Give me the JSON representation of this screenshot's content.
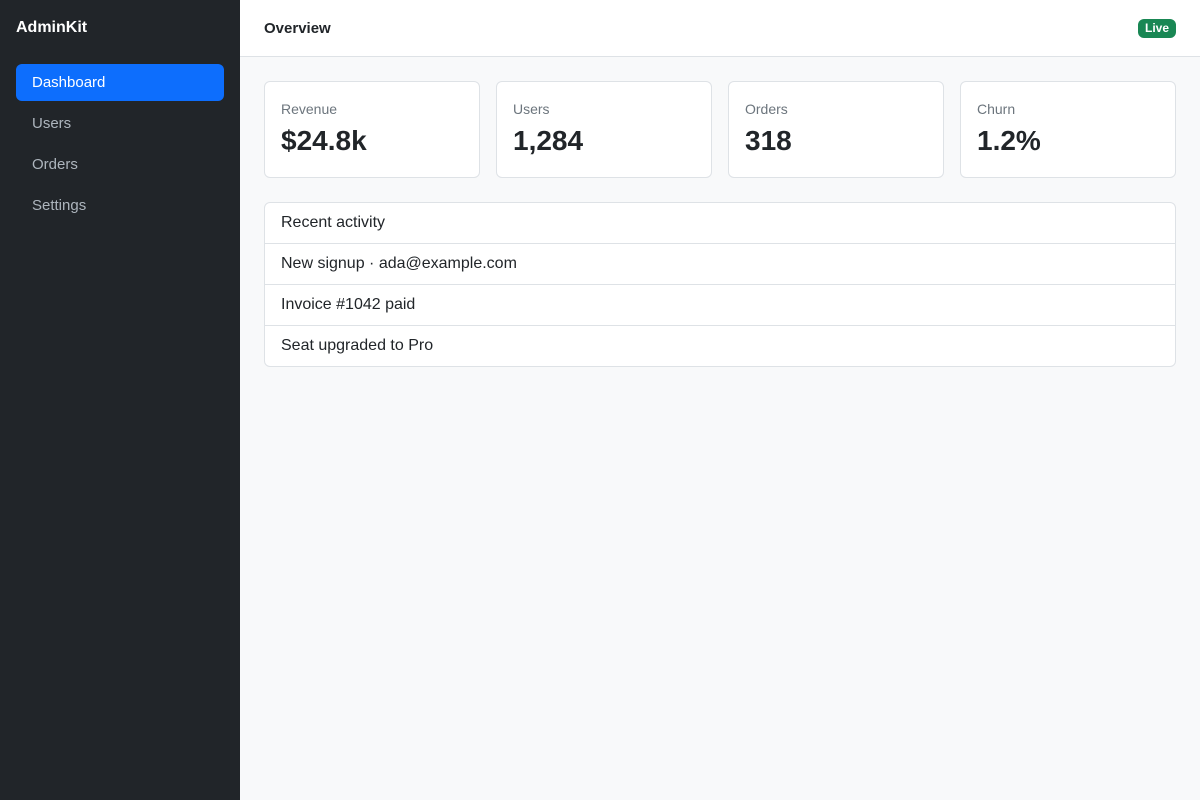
{
  "app": {
    "brand": "AdminKit"
  },
  "sidebar": {
    "items": [
      {
        "label": "Dashboard",
        "active": true
      },
      {
        "label": "Users",
        "active": false
      },
      {
        "label": "Orders",
        "active": false
      },
      {
        "label": "Settings",
        "active": false
      }
    ]
  },
  "header": {
    "title": "Overview",
    "badge": "Live"
  },
  "stats": [
    {
      "label": "Revenue",
      "value": "$24.8k"
    },
    {
      "label": "Users",
      "value": "1,284"
    },
    {
      "label": "Orders",
      "value": "318"
    },
    {
      "label": "Churn",
      "value": "1.2%"
    }
  ],
  "activity": {
    "title": "Recent activity",
    "items": [
      "New signup · ada@example.com",
      "Invoice #1042 paid",
      "Seat upgraded to Pro"
    ]
  },
  "colors": {
    "sidebar_bg": "#212529",
    "accent": "#0d6efd",
    "badge_live": "#198754",
    "page_bg": "#f8f9fa"
  }
}
